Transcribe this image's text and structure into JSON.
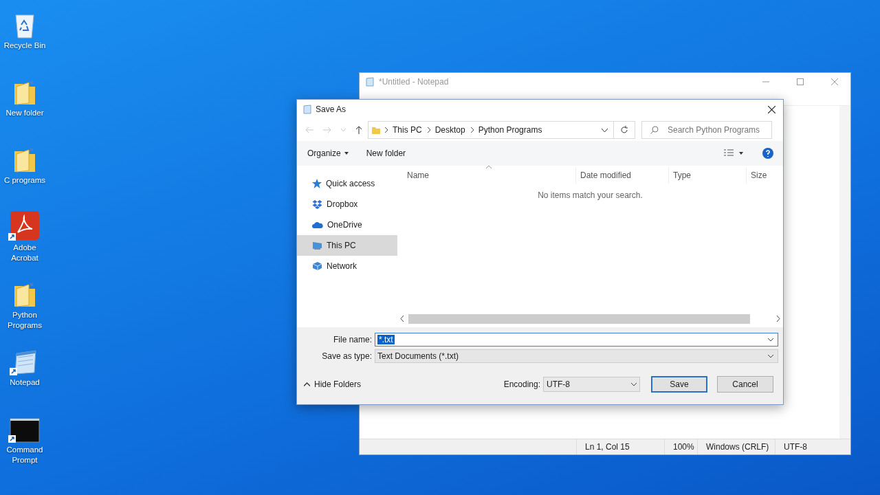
{
  "desktop_icons": [
    {
      "label": "Recycle Bin",
      "kind": "recycle",
      "shortcut": false
    },
    {
      "label": "New folder",
      "kind": "folder",
      "shortcut": false
    },
    {
      "label": "C programs",
      "kind": "folder",
      "shortcut": false
    },
    {
      "label": "Adobe Acrobat",
      "kind": "pdf",
      "shortcut": true
    },
    {
      "label": "Python Programs",
      "kind": "folder",
      "shortcut": false
    },
    {
      "label": "Notepad",
      "kind": "notepad",
      "shortcut": true
    },
    {
      "label": "Command Prompt",
      "kind": "terminal",
      "shortcut": true
    }
  ],
  "notepad": {
    "title": "*Untitled - Notepad",
    "status_bar": [
      "Ln 1, Col 15",
      "100%",
      "Windows (CRLF)",
      "UTF-8"
    ]
  },
  "save_dialog": {
    "title": "Save As",
    "nav": {
      "back_disabled": true,
      "forward_disabled": true
    },
    "breadcrumb": [
      "This PC",
      "Desktop",
      "Python Programs"
    ],
    "search": {
      "placeholder": "Search Python Programs"
    },
    "toolbar": {
      "organize": "Organize",
      "new_folder": "New folder"
    },
    "columns": [
      "Name",
      "Date modified",
      "Type",
      "Size"
    ],
    "empty_message": "No items match your search.",
    "sidebar": [
      {
        "label": "Quick access",
        "kind": "star",
        "selected": false
      },
      {
        "label": "Dropbox",
        "kind": "dropbox",
        "selected": false
      },
      {
        "label": "OneDrive",
        "kind": "cloud",
        "selected": false
      },
      {
        "label": "This PC",
        "kind": "pc",
        "selected": true
      },
      {
        "label": "Network",
        "kind": "network",
        "selected": false
      }
    ],
    "file_name": {
      "label": "File name:",
      "value": "*.txt",
      "selected": true
    },
    "save_as_type": {
      "label": "Save as type:",
      "value": "Text Documents (*.txt)"
    },
    "hide_folders": "Hide Folders",
    "encoding": {
      "label": "Encoding:",
      "value": "UTF-8"
    },
    "buttons": {
      "save": "Save",
      "cancel": "Cancel"
    }
  }
}
